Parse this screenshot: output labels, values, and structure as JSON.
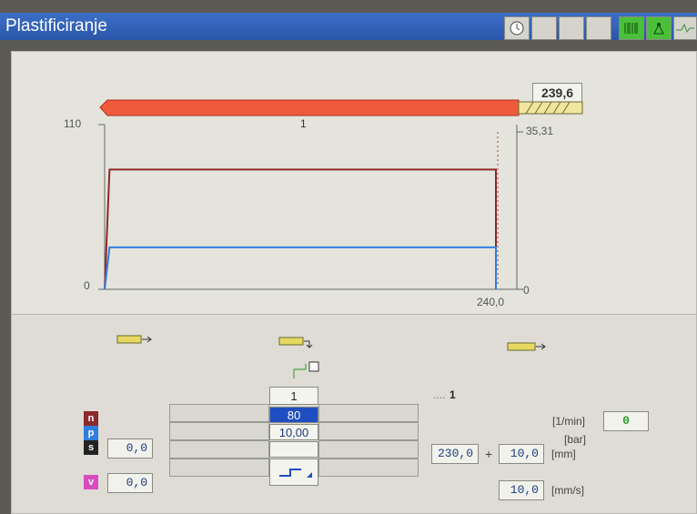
{
  "window": {
    "title": "Plastificiranje"
  },
  "toolbar": {
    "icons": [
      "clock-icon",
      "barcode-icon",
      "hydraulics-icon",
      "waveform-icon"
    ]
  },
  "profile_chart": {
    "y_axis": {
      "max_label": "110",
      "min_label": "0"
    },
    "x_axis": {
      "end_label": "240,0"
    },
    "right_axis": {
      "top_label": "35,31",
      "bottom_label": "0"
    },
    "screw_position": "239,6",
    "screw_bar_label": "1",
    "colors": {
      "speed_curve": "#8b2a2a",
      "pressure_curve": "#2f7fe0",
      "screw_bar": "#f05a3c"
    }
  },
  "chart_data": {
    "type": "line",
    "x": [
      0,
      3,
      240
    ],
    "series": [
      {
        "name": "n",
        "values": [
          0,
          80,
          80
        ]
      },
      {
        "name": "p",
        "values": [
          0,
          28,
          28
        ]
      }
    ],
    "ylim": [
      0,
      110
    ],
    "xlim": [
      0,
      240
    ]
  },
  "parameters": {
    "step_number": "1",
    "step_label_right": "1",
    "speed_value": "80",
    "pressure_value": "10,00",
    "tag_n": "n",
    "tag_p": "p",
    "tag_s": "s",
    "tag_v": "v",
    "s_value": "0,0",
    "v_value": "0,0",
    "unit_speed": "[1/min]",
    "unit_pressure": "[bar]",
    "unit_stroke": "[mm]",
    "unit_velocity": "[mm/s]",
    "speed_actual": "0",
    "stroke_base": "230,0",
    "plus_sign": "+",
    "stroke_decompress": "10,0",
    "velocity_decompress": "10,0"
  }
}
